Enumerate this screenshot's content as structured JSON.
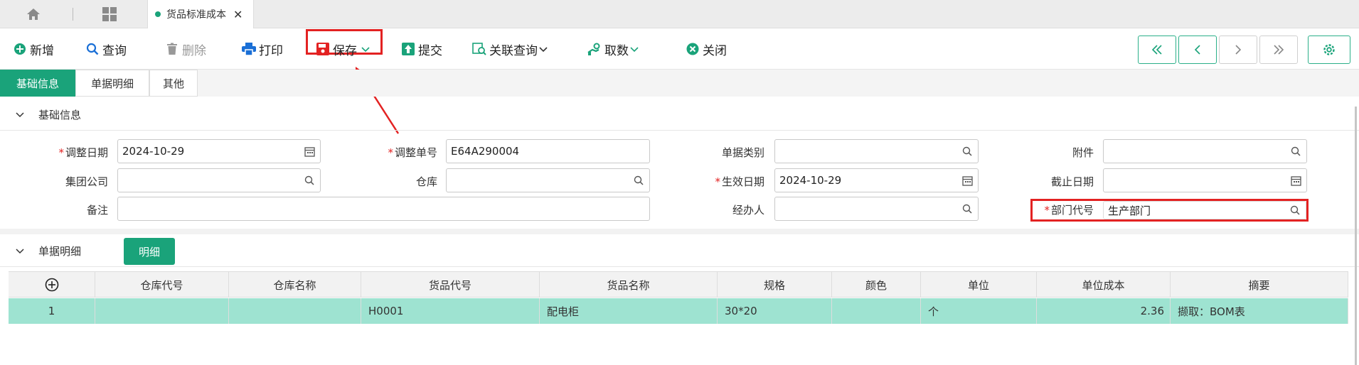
{
  "tabs": {
    "doc_tab_label": "货品标准成本",
    "close_glyph": "✕"
  },
  "toolbar": {
    "add": "新增",
    "query": "查询",
    "delete": "删除",
    "print": "打印",
    "save": "保存",
    "submit": "提交",
    "related_query": "关联查询",
    "fetch": "取数",
    "close": "关闭"
  },
  "subtabs": [
    "基础信息",
    "单据明细",
    "其他"
  ],
  "basic": {
    "section_title": "基础信息",
    "adjust_date_label": "调整日期",
    "adjust_date": "2024-10-29",
    "adjust_no_label": "调整单号",
    "adjust_no": "E64A290004",
    "doc_type_label": "单据类别",
    "doc_type": "",
    "attachment_label": "附件",
    "attachment": "",
    "group_label": "集团公司",
    "group": "",
    "warehouse_label": "仓库",
    "warehouse": "",
    "effective_date_label": "生效日期",
    "effective_date": "2024-10-29",
    "cutoff_date_label": "截止日期",
    "cutoff_date": "",
    "remark_label": "备注",
    "remark": "",
    "handler_label": "经办人",
    "handler": "",
    "dept_label": "部门代号",
    "dept": "生产部门"
  },
  "detail": {
    "section_title": "单据明细",
    "detail_button": "明细",
    "columns": [
      "仓库代号",
      "仓库名称",
      "货品代号",
      "货品名称",
      "规格",
      "颜色",
      "单位",
      "单位成本",
      "摘要"
    ],
    "rows": [
      {
        "idx": "1",
        "wh_code": "",
        "wh_name": "",
        "item_code": "H0001",
        "item_name": "配电柜",
        "spec": "30*20",
        "color": "",
        "unit": "个",
        "cost": "2.36",
        "summary": "撷取：BOM表"
      }
    ]
  },
  "colors": {
    "accent": "#1aa37a",
    "highlight": "#e32222",
    "row_selected": "#9ee3d1"
  }
}
